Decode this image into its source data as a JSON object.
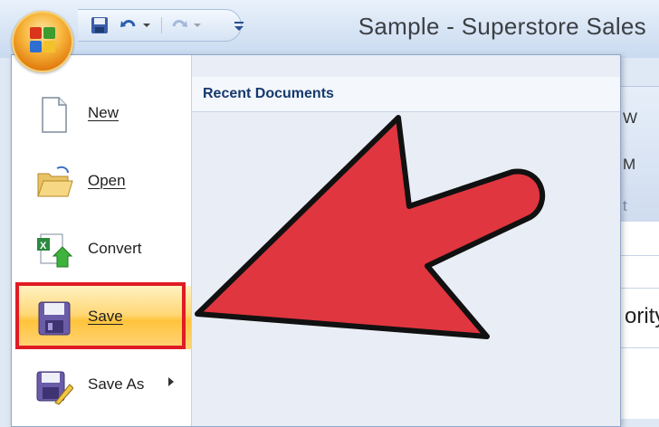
{
  "window": {
    "title": "Sample - Superstore Sales"
  },
  "quick_access": {
    "icons": [
      "save-icon",
      "undo-icon",
      "redo-icon",
      "customize-icon"
    ]
  },
  "office_button": {
    "icon": "office-logo-icon"
  },
  "office_menu": {
    "recent_documents_title": "Recent Documents",
    "items": [
      {
        "label": "New",
        "icon": "new-document-icon"
      },
      {
        "label": "Open",
        "icon": "open-folder-icon"
      },
      {
        "label": "Convert",
        "icon": "convert-icon"
      },
      {
        "label": "Save",
        "icon": "save-icon",
        "highlighted": true
      },
      {
        "label": "Save As",
        "icon": "save-as-icon",
        "has_submenu": true
      }
    ]
  },
  "background_ribbon": {
    "fragments": [
      "W",
      "M",
      "t"
    ],
    "cell_text": "ority"
  },
  "colors": {
    "highlight_box": "#e01b24",
    "annotation_arrow": "#e0363f",
    "active_item": "#ffd776",
    "ribbon_blue": "#15396e"
  }
}
